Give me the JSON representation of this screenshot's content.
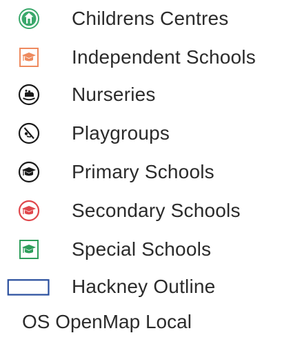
{
  "legend": {
    "items": [
      {
        "label": "Childrens Centres",
        "icon": "childrens-centre-icon",
        "color": "#3aa86b"
      },
      {
        "label": "Independent Schools",
        "icon": "independent-school-icon",
        "color": "#ee8a5e"
      },
      {
        "label": "Nurseries",
        "icon": "nursery-icon",
        "color": "#1a1a1a"
      },
      {
        "label": "Playgroups",
        "icon": "playgroup-icon",
        "color": "#1a1a1a"
      },
      {
        "label": "Primary Schools",
        "icon": "primary-school-icon",
        "color": "#1a1a1a"
      },
      {
        "label": "Secondary Schools",
        "icon": "secondary-school-icon",
        "color": "#e0474c"
      },
      {
        "label": "Special Schools",
        "icon": "special-school-icon",
        "color": "#2e9e5b"
      },
      {
        "label": "Hackney Outline",
        "icon": "hackney-outline-swatch",
        "color": "#2a4f9e"
      }
    ],
    "basemap": "OS OpenMap Local"
  }
}
